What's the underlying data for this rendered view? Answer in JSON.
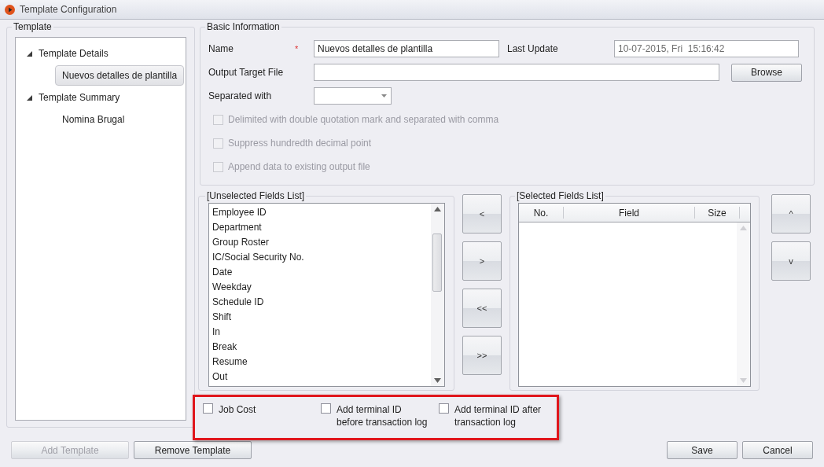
{
  "window": {
    "title": "Template Configuration"
  },
  "template_panel": {
    "title": "Template",
    "tree": [
      {
        "label": "Template Details",
        "expanded": true,
        "children": [
          {
            "label": "Nuevos detalles de plantilla",
            "selected": true
          }
        ]
      },
      {
        "label": "Template Summary",
        "expanded": true,
        "children": [
          {
            "label": "Nomina Brugal",
            "selected": false
          }
        ]
      }
    ]
  },
  "basic_information": {
    "title": "Basic Information",
    "name_field": {
      "label": "Name",
      "required_mark": "*",
      "value": "Nuevos detalles de plantilla"
    },
    "last_update": {
      "label": "Last Update",
      "value": "10-07-2015, Fri  15:16:42",
      "disabled": true
    },
    "output_target": {
      "label": "Output Target File",
      "button": "Browse"
    },
    "separated_with": {
      "label": "Separated with"
    },
    "options": [
      {
        "label": "Delimited with double quotation mark and separated with comma",
        "checked": false,
        "disabled": true
      },
      {
        "label": "Suppress hundredth decimal point",
        "checked": false,
        "disabled": true
      },
      {
        "label": "Append data to existing output file",
        "checked": false,
        "disabled": true
      }
    ]
  },
  "unselected_fields": {
    "title": "[Unselected Fields List]",
    "items": [
      "Employee ID",
      "Department",
      "Group Roster",
      "IC/Social Security No.",
      "Date",
      "Weekday",
      "Schedule ID",
      "Shift",
      "In",
      "Break",
      "Resume",
      "Out"
    ]
  },
  "move_buttons": [
    "<",
    ">",
    "<<",
    ">>"
  ],
  "selected_fields": {
    "title": "[Selected Fields List]",
    "columns": [
      "No.",
      "Field",
      "Size"
    ]
  },
  "order_buttons": [
    "^",
    "v"
  ],
  "extra_options": [
    {
      "label": "Job Cost",
      "checked": false
    },
    {
      "label": "Add terminal ID before transaction log",
      "checked": false
    },
    {
      "label": "Add terminal ID after transaction log",
      "checked": false
    }
  ],
  "footer": {
    "left_buttons": [
      {
        "label": "Add Template",
        "disabled": true
      },
      {
        "label": "Remove Template",
        "disabled": false
      }
    ],
    "right_buttons": [
      {
        "label": "Save",
        "disabled": false
      },
      {
        "label": "Cancel",
        "disabled": false
      }
    ]
  }
}
